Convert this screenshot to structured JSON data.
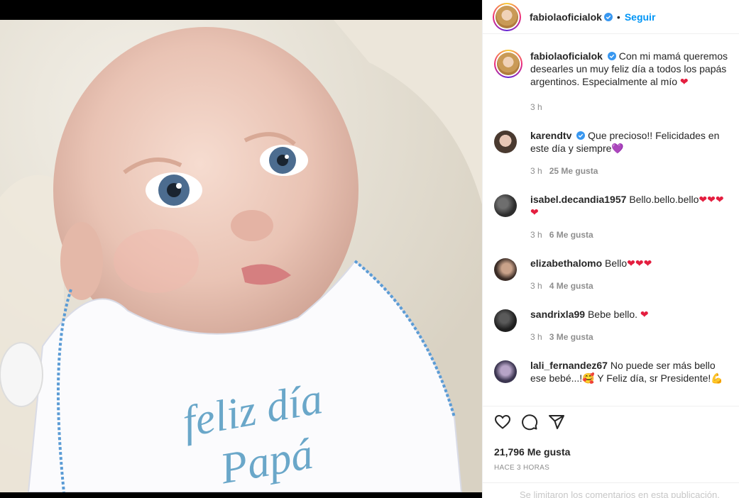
{
  "post": {
    "username": "fabiolaoficialok",
    "follow_label": "Seguir",
    "separator": "•",
    "photo_alt": "baby",
    "bib_line1": "feliz día",
    "bib_line2": "Papá"
  },
  "caption": {
    "username": "fabiolaoficialok",
    "text": "Con mi mamá queremos desearles un muy feliz día a todos los papás argentinos. Especialmente al mío",
    "emoji": "❤",
    "time": "3 h"
  },
  "comments": [
    {
      "username": "karendtv",
      "verified": true,
      "text": "Que precioso!! Felicidades en este día y siempre",
      "emoji": "💜",
      "time": "3 h",
      "likes": "25 Me gusta"
    },
    {
      "username": "isabel.decandia1957",
      "verified": false,
      "text": "Bello.bello.bello",
      "emoji": "❤❤❤ ❤",
      "time": "3 h",
      "likes": "6 Me gusta"
    },
    {
      "username": "elizabethalomo",
      "verified": false,
      "text": "Bello",
      "emoji": "❤❤❤",
      "time": "3 h",
      "likes": "4 Me gusta"
    },
    {
      "username": "sandrixla99",
      "verified": false,
      "text": "Bebe bello.",
      "emoji": "❤",
      "time": "3 h",
      "likes": "3 Me gusta"
    },
    {
      "username": "lali_fernandez67",
      "verified": false,
      "text": "No puede ser más bello ese bebé...!🥰 Y Feliz día, sr Presidente!💪",
      "emoji": "",
      "time": "",
      "likes": ""
    }
  ],
  "footer": {
    "likes_count": "21,796 Me gusta",
    "time_ago": "HACE 3 HORAS",
    "limited_comments": "Se limitaron los comentarios en esta publicación."
  },
  "icons": [
    "heart-icon",
    "comment-icon",
    "share-icon",
    "verified-icon"
  ],
  "colors": {
    "accent": "#0095f6",
    "verified": "#3897f0",
    "heart": "#e41e3f"
  }
}
